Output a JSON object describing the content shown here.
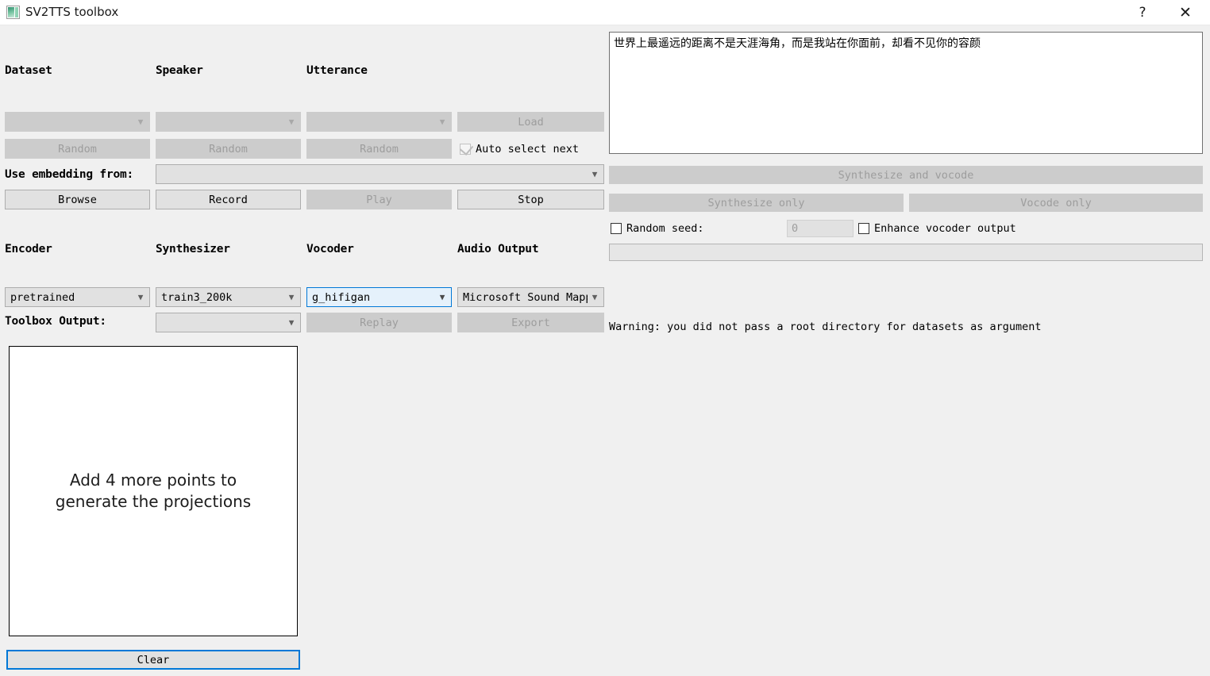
{
  "window": {
    "title": "SV2TTS toolbox",
    "icon": "app-icon",
    "help_label": "?",
    "close_label": "✕"
  },
  "left_panel": {
    "labels": {
      "dataset": "Dataset",
      "speaker": "Speaker",
      "utterance": "Utterance",
      "use_embedding_from": "Use embedding from:",
      "encoder": "Encoder",
      "synthesizer": "Synthesizer",
      "vocoder": "Vocoder",
      "audio_output": "Audio Output",
      "toolbox_output": "Toolbox Output:"
    },
    "dataset_combo": {
      "value": "",
      "state": "disabled"
    },
    "speaker_combo": {
      "value": "",
      "state": "disabled"
    },
    "utterance_combo": {
      "value": "",
      "state": "disabled"
    },
    "load_button": {
      "label": "Load",
      "state": "disabled"
    },
    "random_dataset_button": {
      "label": "Random",
      "state": "disabled"
    },
    "random_speaker_button": {
      "label": "Random",
      "state": "disabled"
    },
    "random_utterance_button": {
      "label": "Random",
      "state": "disabled"
    },
    "auto_select_next": {
      "label": "Auto select next",
      "checked": true,
      "state": "disabled"
    },
    "embedding_combo": {
      "value": "",
      "state": "enabled"
    },
    "browse_button": {
      "label": "Browse",
      "state": "enabled"
    },
    "record_button": {
      "label": "Record",
      "state": "enabled"
    },
    "play_button": {
      "label": "Play",
      "state": "disabled"
    },
    "stop_button": {
      "label": "Stop",
      "state": "enabled"
    },
    "encoder_combo": {
      "value": "pretrained",
      "state": "enabled"
    },
    "synthesizer_combo": {
      "value": "train3_200k",
      "state": "enabled"
    },
    "vocoder_combo": {
      "value": "g_hifigan",
      "state": "focused"
    },
    "audio_output_combo": {
      "value": "Microsoft Sound Mapp",
      "state": "enabled"
    },
    "toolbox_output_combo": {
      "value": "",
      "state": "enabled"
    },
    "replay_button": {
      "label": "Replay",
      "state": "disabled"
    },
    "export_button": {
      "label": "Export",
      "state": "disabled"
    },
    "projection_message": "Add 4 more points to\ngenerate the projections",
    "clear_button": {
      "label": "Clear",
      "state": "focused"
    }
  },
  "right_panel": {
    "text_input": {
      "value": "世界上最遥远的距离不是天涯海角，而是我站在你面前，却看不见你的容颜"
    },
    "synthesize_and_vocode_button": {
      "label": "Synthesize and vocode",
      "state": "disabled"
    },
    "synthesize_only_button": {
      "label": "Synthesize only",
      "state": "disabled"
    },
    "vocode_only_button": {
      "label": "Vocode only",
      "state": "disabled"
    },
    "random_seed": {
      "label": "Random seed:",
      "checked": false,
      "state": "enabled"
    },
    "seed_value": "0",
    "enhance_vocoder_output": {
      "label": "Enhance vocoder output",
      "checked": false,
      "state": "enabled"
    },
    "progress_value": "",
    "warning": "Warning: you did not pass a root directory for datasets as argument"
  },
  "colors": {
    "window_bg": "#f0f0f0",
    "accent_focus": "#0078d7",
    "disabled_bg": "#cccccc",
    "enabled_bg": "#e1e1e1",
    "focus_fill": "#e5f1fb",
    "text": "#000000",
    "disabled_text": "#9d9d9d"
  }
}
